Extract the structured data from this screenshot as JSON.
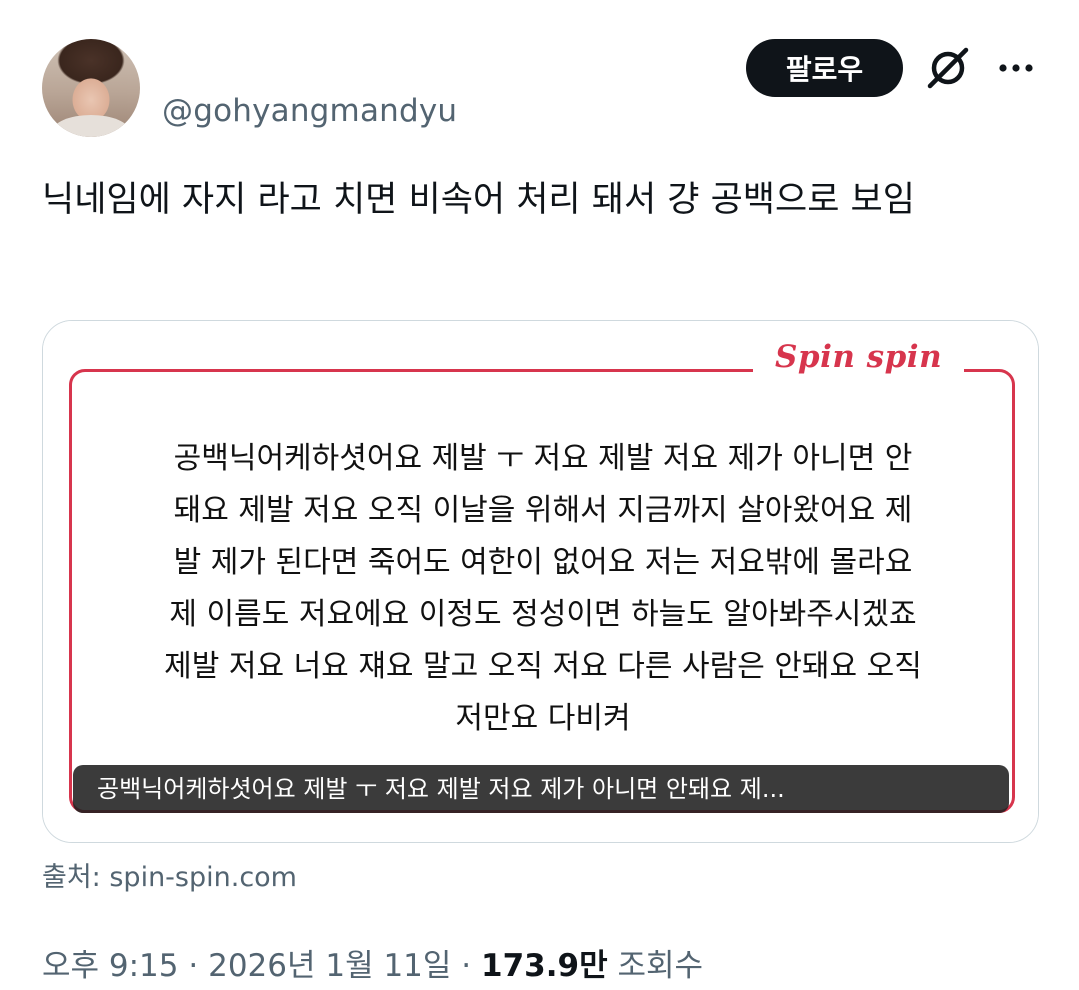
{
  "author": {
    "handle": "@gohyangmandyu"
  },
  "actions": {
    "follow_label": "팔로우",
    "grok_icon": "grok-icon",
    "more_icon": "more-dots-icon"
  },
  "tweet": {
    "text": "닉네임에 자지 라고 치면 비속어 처리 돼서 걍 공백으로 보임"
  },
  "card": {
    "brand": "Spin spin",
    "body_lines": [
      "공백닉어케하셧어요 제발 ㅜ 저요 제발 저요 제가 아니면 안",
      "돼요 제발 저요 오직 이날을 위해서 지금까지 살아왔어요 제",
      "발 제가 된다면 죽어도 여한이 없어요 저는 저요밖에 몰라요",
      "제 이름도 저요에요 이정도 정성이면 하늘도 알아봐주시겠죠",
      "제발 저요 너요 쟤요 말고 오직 저요 다른 사람은 안돼요 오직",
      "저만요 다비켜"
    ],
    "caption": "공백닉어케하셧어요 제발 ㅜ 저요 제발 저요 제가 아니면 안돼요 제...",
    "accent_color": "#d7354d"
  },
  "source": {
    "label": "출처: spin-spin.com"
  },
  "meta": {
    "time": "오후 9:15",
    "separator": "·",
    "date": "2026년 1월 11일",
    "views_count": "173.9만",
    "views_label": "조회수"
  }
}
